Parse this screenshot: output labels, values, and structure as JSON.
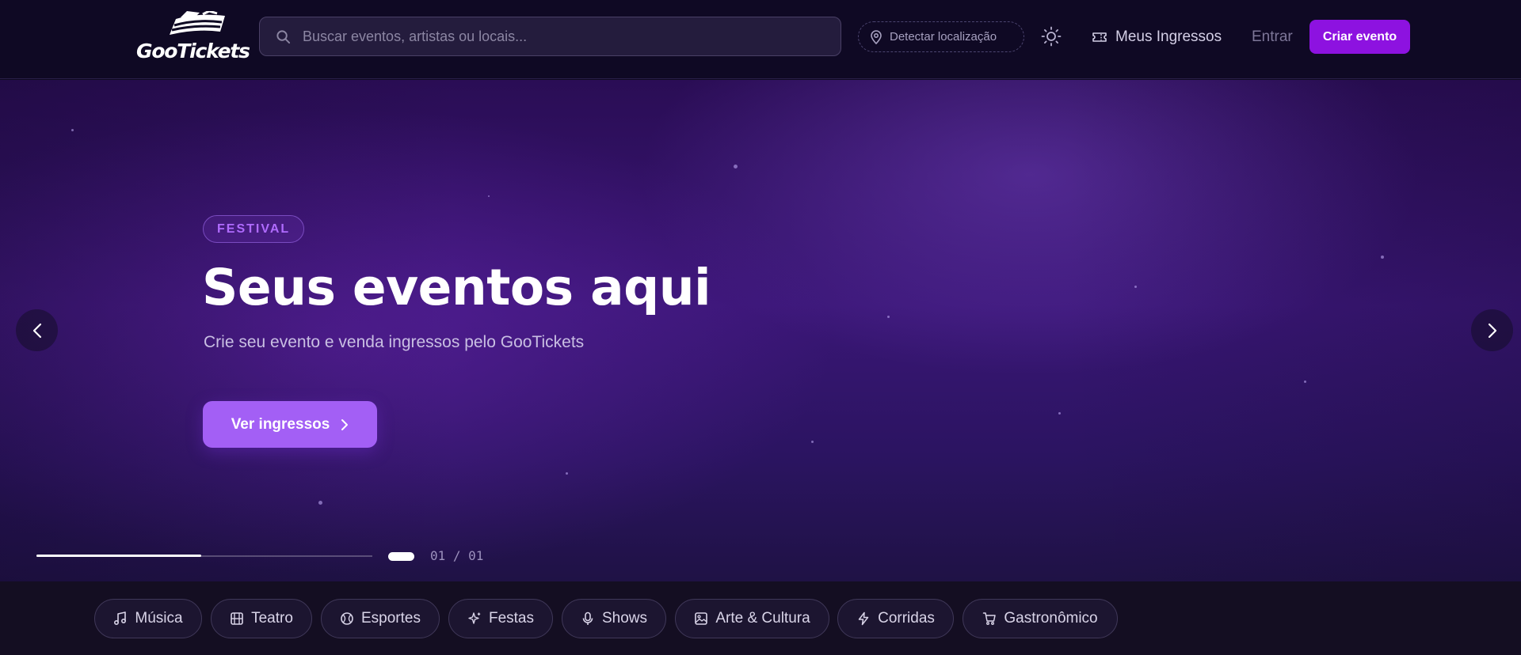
{
  "header": {
    "logo_text": "GooTickets",
    "search_placeholder": "Buscar eventos, artistas ou locais...",
    "detect_location": "Detectar localização",
    "my_tickets": "Meus Ingressos",
    "login": "Entrar",
    "create_event": "Criar evento"
  },
  "hero": {
    "badge": "FESTIVAL",
    "title": "Seus eventos aqui",
    "subtitle": "Crie seu evento e venda ingressos pelo GooTickets",
    "cta": "Ver ingressos",
    "slide_counter": "01 / 01",
    "progress": 0.49
  },
  "categories": [
    {
      "label": "Música",
      "icon": "music-note-icon"
    },
    {
      "label": "Teatro",
      "icon": "film-icon"
    },
    {
      "label": "Esportes",
      "icon": "ball-icon"
    },
    {
      "label": "Festas",
      "icon": "sparkles-icon"
    },
    {
      "label": "Shows",
      "icon": "microphone-icon"
    },
    {
      "label": "Arte & Cultura",
      "icon": "image-icon"
    },
    {
      "label": "Corridas",
      "icon": "lightning-icon"
    },
    {
      "label": "Gastronômico",
      "icon": "cart-icon"
    }
  ],
  "colors": {
    "accent": "#8d12e0",
    "cta": "#a35ff5",
    "badge_text": "#b06bff",
    "header_bg": "#0f0924"
  }
}
